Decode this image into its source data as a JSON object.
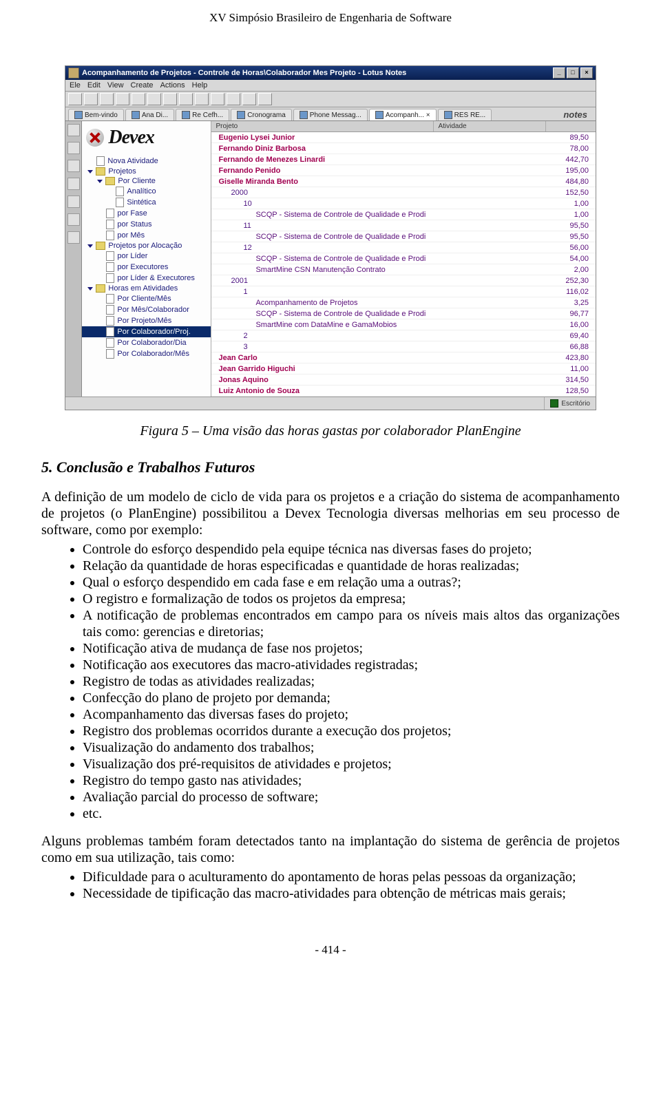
{
  "header": {
    "conference": "XV Simpósio Brasileiro de Engenharia de Software",
    "page_number": "- 414 -"
  },
  "screenshot": {
    "title": "Acompanhamento de Projetos - Controle de Horas\\Colaborador Mes Projeto - Lotus Notes",
    "notes_brand": "notes",
    "menu": [
      "Ele",
      "Edit",
      "View",
      "Create",
      "Actions",
      "Help"
    ],
    "tabs": [
      "Bem-vindo",
      "Ana Di...",
      "Re Cefh...",
      "Cronograma",
      "Phone Messag...",
      "Acompanh... ×",
      "RES RE..."
    ],
    "columns": {
      "c1": "Projeto",
      "c2": "Atividade",
      "c3": ""
    },
    "statusbar": {
      "right": "Escritório"
    },
    "logo_text": "Devex",
    "nav": [
      {
        "label": "Nova Atividade",
        "level": 0,
        "type": "doc",
        "tw": "none"
      },
      {
        "label": "Projetos",
        "level": 0,
        "type": "folder",
        "tw": "down"
      },
      {
        "label": "Por Cliente",
        "level": 1,
        "type": "folder",
        "tw": "down"
      },
      {
        "label": "Analítico",
        "level": 2,
        "type": "doc",
        "tw": "none"
      },
      {
        "label": "Sintética",
        "level": 2,
        "type": "doc",
        "tw": "none"
      },
      {
        "label": "por Fase",
        "level": 1,
        "type": "doc",
        "tw": "none"
      },
      {
        "label": "por Status",
        "level": 1,
        "type": "doc",
        "tw": "none"
      },
      {
        "label": "por Mês",
        "level": 1,
        "type": "doc",
        "tw": "none"
      },
      {
        "label": "Projetos por Alocação",
        "level": 0,
        "type": "folder",
        "tw": "down"
      },
      {
        "label": "por Líder",
        "level": 1,
        "type": "doc",
        "tw": "none"
      },
      {
        "label": "por Executores",
        "level": 1,
        "type": "doc",
        "tw": "none"
      },
      {
        "label": "por Líder & Executores",
        "level": 1,
        "type": "doc",
        "tw": "none"
      },
      {
        "label": "Horas em Atividades",
        "level": 0,
        "type": "folder",
        "tw": "down"
      },
      {
        "label": "Por Cliente/Mês",
        "level": 1,
        "type": "doc",
        "tw": "none"
      },
      {
        "label": "Por Mês/Colaborador",
        "level": 1,
        "type": "doc",
        "tw": "none"
      },
      {
        "label": "Por Projeto/Mês",
        "level": 1,
        "type": "doc",
        "tw": "none"
      },
      {
        "label": "Por Colaborador/Proj.",
        "level": 1,
        "type": "doc",
        "tw": "none",
        "selected": true
      },
      {
        "label": "Por Colaborador/Dia",
        "level": 1,
        "type": "doc",
        "tw": "none"
      },
      {
        "label": "Por Colaborador/Mês",
        "level": 1,
        "type": "doc",
        "tw": "none"
      }
    ],
    "rows": [
      {
        "label": "Eugenio Lysei Junior",
        "value": "89,50",
        "level": 0,
        "tw": "right"
      },
      {
        "label": "Fernando Diniz Barbosa",
        "value": "78,00",
        "level": 0,
        "tw": "right"
      },
      {
        "label": "Fernando de Menezes Linardi",
        "value": "442,70",
        "level": 0,
        "tw": "right"
      },
      {
        "label": "Fernando Penido",
        "value": "195,00",
        "level": 0,
        "tw": "right"
      },
      {
        "label": "Giselle Miranda Bento",
        "value": "484,80",
        "level": 0,
        "tw": "down"
      },
      {
        "label": "2000",
        "value": "152,50",
        "level": 1,
        "tw": "down"
      },
      {
        "label": "10",
        "value": "1,00",
        "level": 2,
        "tw": "down"
      },
      {
        "label": "SCQP - Sistema de Controle de Qualidade e Prodi",
        "value": "1,00",
        "level": 3,
        "tw": "right"
      },
      {
        "label": "11",
        "value": "95,50",
        "level": 2,
        "tw": "down"
      },
      {
        "label": "SCQP - Sistema de Controle de Qualidade e Prodi",
        "value": "95,50",
        "level": 3,
        "tw": "right"
      },
      {
        "label": "12",
        "value": "56,00",
        "level": 2,
        "tw": "down"
      },
      {
        "label": "SCQP - Sistema de Controle de Qualidade e Prodi",
        "value": "54,00",
        "level": 3,
        "tw": "right"
      },
      {
        "label": "SmartMine CSN Manutenção Contrato",
        "value": "2,00",
        "level": 3,
        "tw": "right"
      },
      {
        "label": "2001",
        "value": "252,30",
        "level": 1,
        "tw": "down"
      },
      {
        "label": "1",
        "value": "116,02",
        "level": 2,
        "tw": "down"
      },
      {
        "label": "Acompanhamento de Projetos",
        "value": "3,25",
        "level": 3,
        "tw": "right"
      },
      {
        "label": "SCQP - Sistema de Controle de Qualidade e Prodi",
        "value": "96,77",
        "level": 3,
        "tw": "right"
      },
      {
        "label": "SmartMine com DataMine e GamaMobios",
        "value": "16,00",
        "level": 3,
        "tw": "right"
      },
      {
        "label": "2",
        "value": "69,40",
        "level": 2,
        "tw": "right"
      },
      {
        "label": "3",
        "value": "66,88",
        "level": 2,
        "tw": "right"
      },
      {
        "label": "Jean Carlo",
        "value": "423,80",
        "level": 0,
        "tw": "right"
      },
      {
        "label": "Jean Garrido Higuchi",
        "value": "11,00",
        "level": 0,
        "tw": "right"
      },
      {
        "label": "Jonas Aquino",
        "value": "314,50",
        "level": 0,
        "tw": "right"
      },
      {
        "label": "Luiz Antonio de Souza",
        "value": "128,50",
        "level": 0,
        "tw": "right"
      }
    ]
  },
  "figure_caption": "Figura 5 – Uma visão das horas gastas por colaborador PlanEngine",
  "section_title": "5.  Conclusão e Trabalhos Futuros",
  "intro_paragraph": "A definição de um modelo de ciclo de vida para os projetos e a criação do sistema de acompanhamento de projetos (o PlanEngine) possibilitou a Devex Tecnologia diversas melhorias em seu processo de software, como por exemplo:",
  "list_a": [
    "Controle do esforço despendido pela equipe técnica nas diversas fases do projeto;",
    "Relação da quantidade de horas especificadas e quantidade de horas realizadas;",
    "Qual o esforço despendido em cada fase e em relação uma a outras?;",
    "O registro e formalização de todos os projetos da empresa;",
    "A notificação de problemas encontrados em campo para os níveis mais altos das organizações tais como: gerencias e diretorias;",
    "Notificação ativa de mudança de fase nos projetos;",
    "Notificação aos executores das macro-atividades registradas;",
    "Registro de todas as atividades realizadas;",
    "Confecção do plano de projeto por demanda;",
    "Acompanhamento das diversas fases do projeto;",
    "Registro dos problemas ocorridos durante a execução dos projetos;",
    "Visualização do andamento dos trabalhos;",
    "Visualização dos pré-requisitos de atividades e projetos;",
    "Registro do tempo gasto nas atividades;",
    "Avaliação parcial do processo de software;",
    "etc."
  ],
  "para_b": "Alguns problemas também foram detectados tanto na implantação do sistema de gerência de projetos como em sua utilização, tais como:",
  "list_b": [
    "Dificuldade para o aculturamento do apontamento de horas pelas pessoas da organização;",
    "Necessidade de tipificação das macro-atividades para obtenção de métricas mais gerais;"
  ]
}
